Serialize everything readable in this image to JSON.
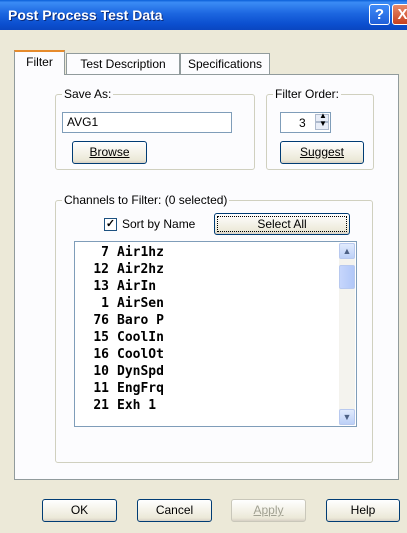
{
  "window": {
    "title": "Post Process Test Data",
    "help_glyph": "?",
    "close_glyph": "X"
  },
  "tabs": [
    {
      "label": "Filter",
      "active": true
    },
    {
      "label": "Test Description",
      "active": false
    },
    {
      "label": "Specifications",
      "active": false
    }
  ],
  "save_as": {
    "legend": "Save As:",
    "value": "AVG1",
    "browse_label": "Browse"
  },
  "filter_order": {
    "legend": "Filter Order:",
    "value": "3",
    "suggest_label": "Suggest"
  },
  "channels": {
    "legend": "Channels to Filter:  (0 selected)",
    "sort_label": "Sort by Name",
    "sort_checked": true,
    "select_all_label": "Select All",
    "items": [
      {
        "num": "7",
        "name": "Air1hz"
      },
      {
        "num": "12",
        "name": "Air2hz"
      },
      {
        "num": "13",
        "name": "AirIn"
      },
      {
        "num": "1",
        "name": "AirSen"
      },
      {
        "num": "76",
        "name": "Baro P"
      },
      {
        "num": "15",
        "name": "CoolIn"
      },
      {
        "num": "16",
        "name": "CoolOt"
      },
      {
        "num": "10",
        "name": "DynSpd"
      },
      {
        "num": "11",
        "name": "EngFrq"
      },
      {
        "num": "21",
        "name": "Exh 1"
      }
    ]
  },
  "footer": {
    "ok": "OK",
    "cancel": "Cancel",
    "apply": "Apply",
    "help": "Help"
  },
  "colors": {
    "titlebar": "#0a4fcf",
    "dialog_bg": "#ece9d8",
    "tab_accent": "#e68b2c"
  }
}
